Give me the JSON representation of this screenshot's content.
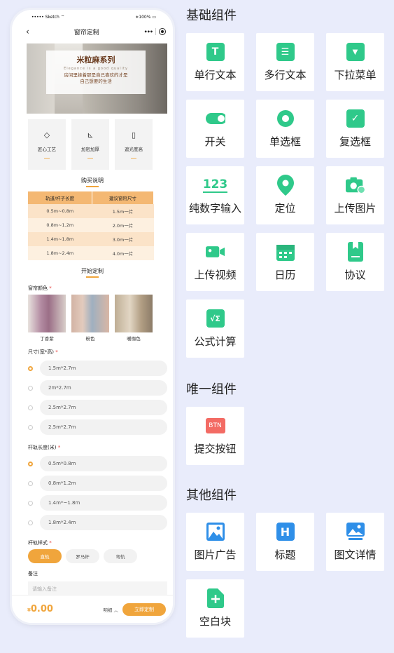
{
  "phone": {
    "status": {
      "carrier": "Sketch",
      "battery": "100%"
    },
    "nav": {
      "title": "窗帘定制",
      "back": "‹",
      "more": "•••"
    },
    "banner": {
      "title": "米粒麻系列",
      "subtitle": "Elegance is a good quality",
      "line1": "房间里挂着那是自己喜欢的才是",
      "line2": "自己想要的生活"
    },
    "features": [
      {
        "icon": "diamond-icon",
        "glyph": "◇",
        "label": "匠心工艺"
      },
      {
        "icon": "ruler-icon",
        "glyph": "⊾",
        "label": "加密加厚"
      },
      {
        "icon": "curtain-icon",
        "glyph": "▯",
        "label": "遮光度高"
      }
    ],
    "buy_title": "购买说明",
    "table": {
      "headers": [
        "轨道/杆子长度",
        "建议窗帘尺寸"
      ],
      "rows": [
        [
          "0.5m~0.8m",
          "1.5m一片"
        ],
        [
          "0.8m~1.2m",
          "2.0m一片"
        ],
        [
          "1.4m~1.8m",
          "3.0m一片"
        ],
        [
          "1.8m~2.4m",
          "4.0m一片"
        ]
      ]
    },
    "custom_title": "开始定制",
    "color_label": "窗帘颜色",
    "swatches": [
      {
        "label": "丁香紫",
        "color": "#c9a8b7"
      },
      {
        "label": "粉色",
        "color": "#d7b7a9"
      },
      {
        "label": "暖咖色",
        "color": "#c8b7a0"
      }
    ],
    "size_label": "尺寸(宽*高)",
    "sizes": [
      "1.5m*2.7m",
      "2m*2.7m",
      "2.5m*2.7m",
      "2.5m*2.7m"
    ],
    "rail_label": "杆轨长度(米)",
    "rails": [
      "0.5m*0.8m",
      "0.8m*1.2m",
      "1.4m*~1.8m",
      "1.8m*2.4m"
    ],
    "style_label": "杆轨样式",
    "styles": [
      "直轨",
      "罗马杆",
      "弯轨"
    ],
    "remark_label": "备注",
    "remark_placeholder": "请输入备注",
    "required_mark": "*",
    "bottom": {
      "currency": "¥",
      "amount": "0.00",
      "detail": "明细",
      "detail_icon": "chevron-up-icon",
      "detail_glyph": "︿",
      "buy": "立即定制"
    }
  },
  "groups": [
    {
      "title": "基础组件",
      "items": [
        {
          "label": "单行文本",
          "icon": "text-icon"
        },
        {
          "label": "多行文本",
          "icon": "textarea-icon"
        },
        {
          "label": "下拉菜单",
          "icon": "dropdown-icon"
        },
        {
          "label": "开关",
          "icon": "switch-icon"
        },
        {
          "label": "单选框",
          "icon": "radio-icon"
        },
        {
          "label": "复选框",
          "icon": "checkbox-icon"
        },
        {
          "label": "纯数字输入",
          "icon": "number-icon",
          "glyph": "123"
        },
        {
          "label": "定位",
          "icon": "location-icon"
        },
        {
          "label": "上传图片",
          "icon": "camera-icon"
        },
        {
          "label": "上传视频",
          "icon": "video-icon"
        },
        {
          "label": "日历",
          "icon": "calendar-icon"
        },
        {
          "label": "协议",
          "icon": "agreement-icon"
        },
        {
          "label": "公式计算",
          "icon": "formula-icon",
          "glyph": "√Σ"
        }
      ]
    },
    {
      "title": "唯一组件",
      "items": [
        {
          "label": "提交按钮",
          "icon": "submit-button-icon",
          "glyph": "BTN"
        }
      ]
    },
    {
      "title": "其他组件",
      "items": [
        {
          "label": "图片广告",
          "icon": "image-ad-icon"
        },
        {
          "label": "标题",
          "icon": "heading-icon",
          "glyph": "H"
        },
        {
          "label": "图文详情",
          "icon": "image-text-icon"
        },
        {
          "label": "空白块",
          "icon": "blank-block-icon"
        }
      ]
    }
  ],
  "colors": {
    "accent": "#f0a53c",
    "green": "#2fc98a",
    "blue": "#2f8fe8",
    "red": "#f36b64",
    "bg": "#e9ecfb"
  }
}
